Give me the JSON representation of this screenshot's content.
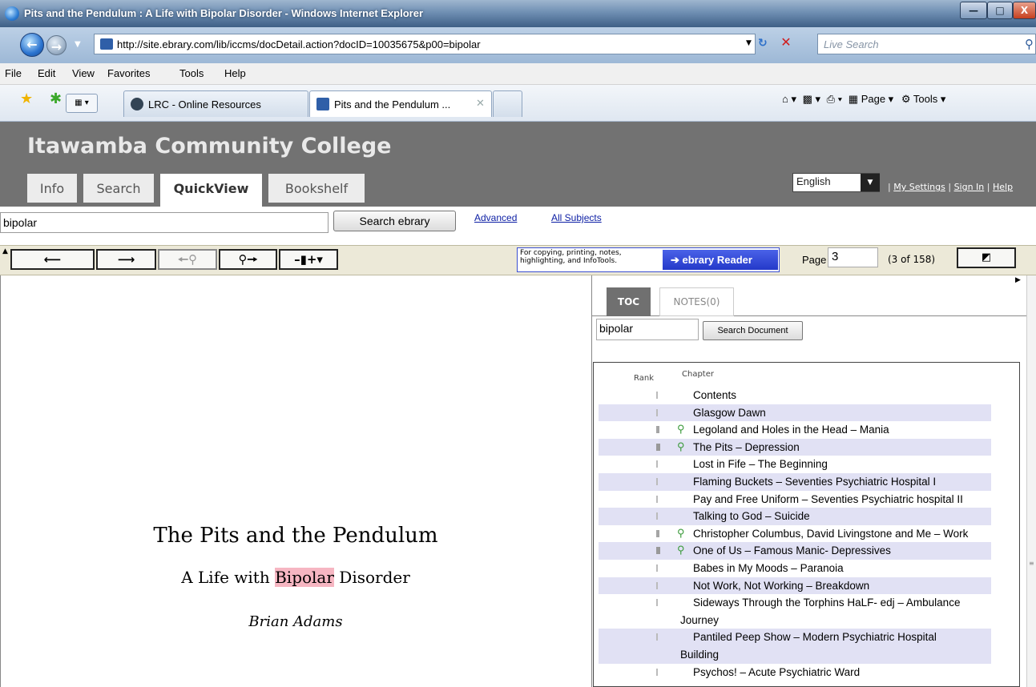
{
  "window": {
    "title": "Pits and the Pendulum : A Life with Bipolar Disorder - Windows Internet Explorer",
    "min_label": "—",
    "max_label": "□",
    "close_label": "X"
  },
  "address": {
    "url": "http://site.ebrary.com/lib/iccms/docDetail.action?docID=10035675&p00=bipolar",
    "search_placeholder": "Live Search"
  },
  "menu": [
    "File",
    "Edit",
    "View",
    "Favorites",
    "Tools",
    "Help"
  ],
  "tabs": [
    {
      "label": "LRC - Online Resources"
    },
    {
      "label": "Pits and the Pendulum ...",
      "close": "✕"
    }
  ],
  "commandbar": {
    "page": "Page",
    "tools": "Tools"
  },
  "site": {
    "college": "Itawamba Community College",
    "nav_tabs": [
      "Info",
      "Search",
      "QuickView",
      "Bookshelf"
    ],
    "language": "English",
    "links": {
      "sep": "|",
      "settings": "My Settings",
      "signin": "Sign In",
      "help": "Help"
    },
    "search_value": "bipolar",
    "search_button": "Search ebrary",
    "advanced": "Advanced",
    "all_subjects": "All Subjects"
  },
  "toolbar": {
    "reader_text": "For copying, printing, notes, highlighting, and InfoTools.",
    "reader_button": "ebrary Reader",
    "page_label": "Page",
    "page_value": "3",
    "page_count": "(3 of 158)"
  },
  "document": {
    "title": "The Pits and the Pendulum",
    "subtitle_pre": "A Life with ",
    "subtitle_hl": "Bipolar",
    "subtitle_post": " Disorder",
    "author": "Brian Adams"
  },
  "sidepanel": {
    "tab_toc": "TOC",
    "tab_notes": "NOTES(0)",
    "search_value": "bipolar",
    "search_button": "Search Document",
    "rank_header": "Rank",
    "chapter_header": "Chapter",
    "chapters": [
      {
        "title": "Contents",
        "rank": 1,
        "hit": false
      },
      {
        "title": "Glasgow Dawn",
        "rank": 1,
        "hit": false
      },
      {
        "title": "Legoland and Holes in the Head – Mania",
        "rank": 2,
        "hit": true
      },
      {
        "title": "The Pits – Depression",
        "rank": 3,
        "hit": true
      },
      {
        "title": "Lost in Fife – The Beginning",
        "rank": 1,
        "hit": false
      },
      {
        "title": "Flaming Buckets – Seventies Psychiatric Hospital I",
        "rank": 1,
        "hit": false
      },
      {
        "title": "Pay and Free Uniform – Seventies Psychiatric hospital II",
        "rank": 1,
        "hit": false
      },
      {
        "title": "Talking to God – Suicide",
        "rank": 1,
        "hit": false
      },
      {
        "title": "Christopher Columbus, David Livingstone and Me – Work",
        "rank": 2,
        "hit": true
      },
      {
        "title": "One of Us – Famous Manic- Depressives",
        "rank": 3,
        "hit": true
      },
      {
        "title": "Babes in My Moods – Paranoia",
        "rank": 1,
        "hit": false
      },
      {
        "title": "Not Work, Not Working – Breakdown",
        "rank": 1,
        "hit": false
      },
      {
        "title": "Sideways Through the Torphins HaLF- edj – Ambulance",
        "title2": "Journey",
        "rank": 1,
        "hit": false
      },
      {
        "title": "Pantiled Peep Show – Modern Psychiatric Hospital",
        "title2": "Building",
        "rank": 1,
        "hit": false
      },
      {
        "title": "Psychos! – Acute Psychiatric Ward",
        "rank": 1,
        "hit": false
      }
    ]
  }
}
